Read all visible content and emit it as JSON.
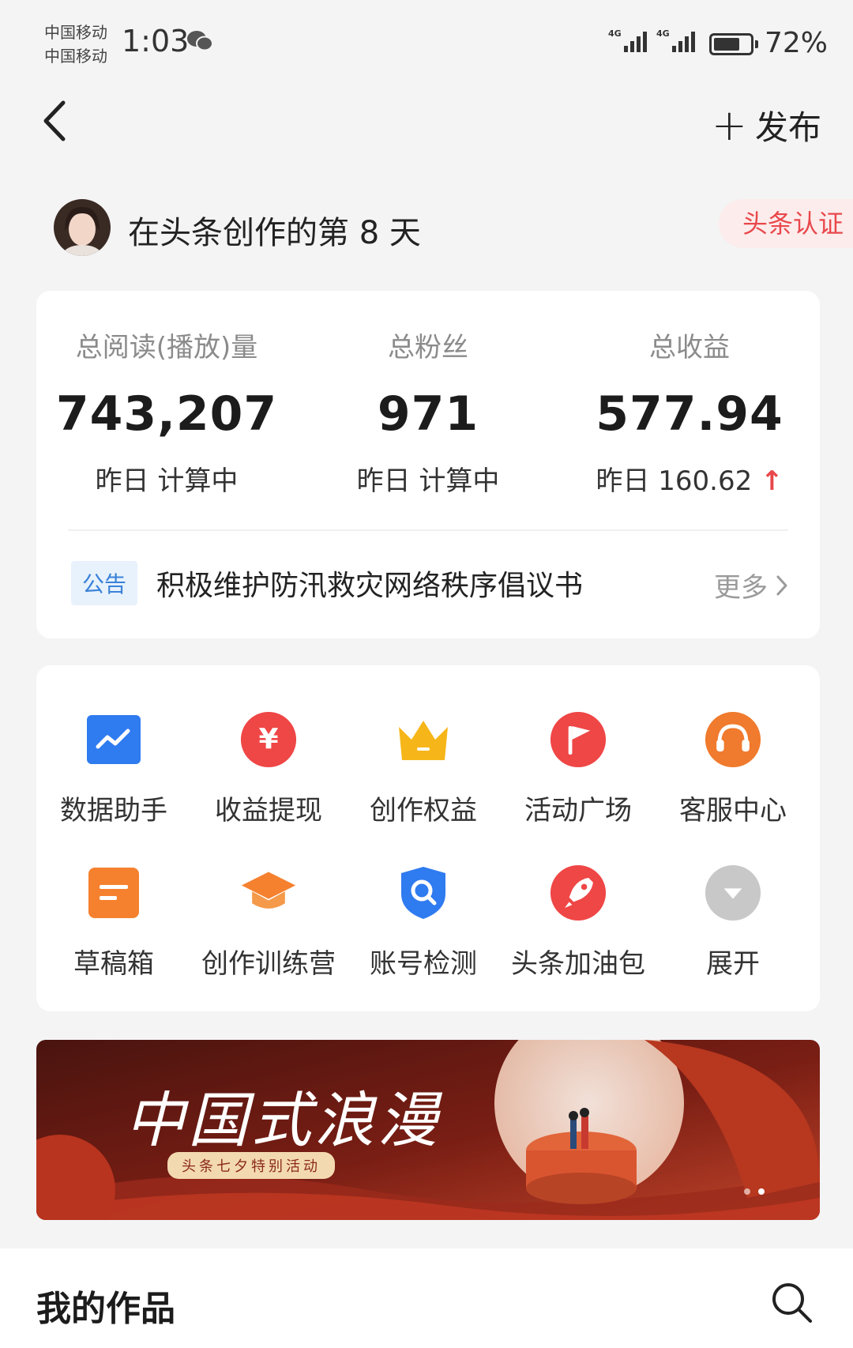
{
  "status_bar": {
    "carrier_1": "中国移动",
    "carrier_2": "中国移动",
    "time": "1:03",
    "network_1": "4G",
    "network_2": "4G",
    "battery": "72%"
  },
  "nav": {
    "publish_label": "发布"
  },
  "profile": {
    "title": "在头条创作的第 8 天",
    "badge": "头条认证"
  },
  "stats": [
    {
      "label": "总阅读(播放)量",
      "value": "743,207",
      "sub": "昨日 计算中"
    },
    {
      "label": "总粉丝",
      "value": "971",
      "sub": "昨日 计算中"
    },
    {
      "label": "总收益",
      "value": "577.94",
      "sub": "昨日 160.62",
      "trend": "↑"
    }
  ],
  "notice": {
    "tag": "公告",
    "text": "积极维护防汛救灾网络秩序倡议书",
    "more": "更多"
  },
  "tools": [
    {
      "label": "数据助手",
      "icon": "data-chart-icon",
      "color": "#2f7bf0"
    },
    {
      "label": "收益提现",
      "icon": "yuan-icon",
      "color": "#ef4646"
    },
    {
      "label": "创作权益",
      "icon": "crown-icon",
      "color": "#f6b619"
    },
    {
      "label": "活动广场",
      "icon": "flag-icon",
      "color": "#ef4646"
    },
    {
      "label": "客服中心",
      "icon": "headset-icon",
      "color": "#f07a2d"
    },
    {
      "label": "草稿箱",
      "icon": "draft-icon",
      "color": "#f5812f"
    },
    {
      "label": "创作训练营",
      "icon": "graduation-cap-icon",
      "color": "#f5812f"
    },
    {
      "label": "账号检测",
      "icon": "shield-search-icon",
      "color": "#2f7bf0"
    },
    {
      "label": "头条加油包",
      "icon": "rocket-icon",
      "color": "#ef4646"
    },
    {
      "label": "展开",
      "icon": "expand-icon",
      "color": "#c8c8c8"
    }
  ],
  "banner": {
    "title": "中国式浪漫",
    "subtitle": "头条七夕特别活动"
  },
  "works": {
    "title": "我的作品"
  }
}
